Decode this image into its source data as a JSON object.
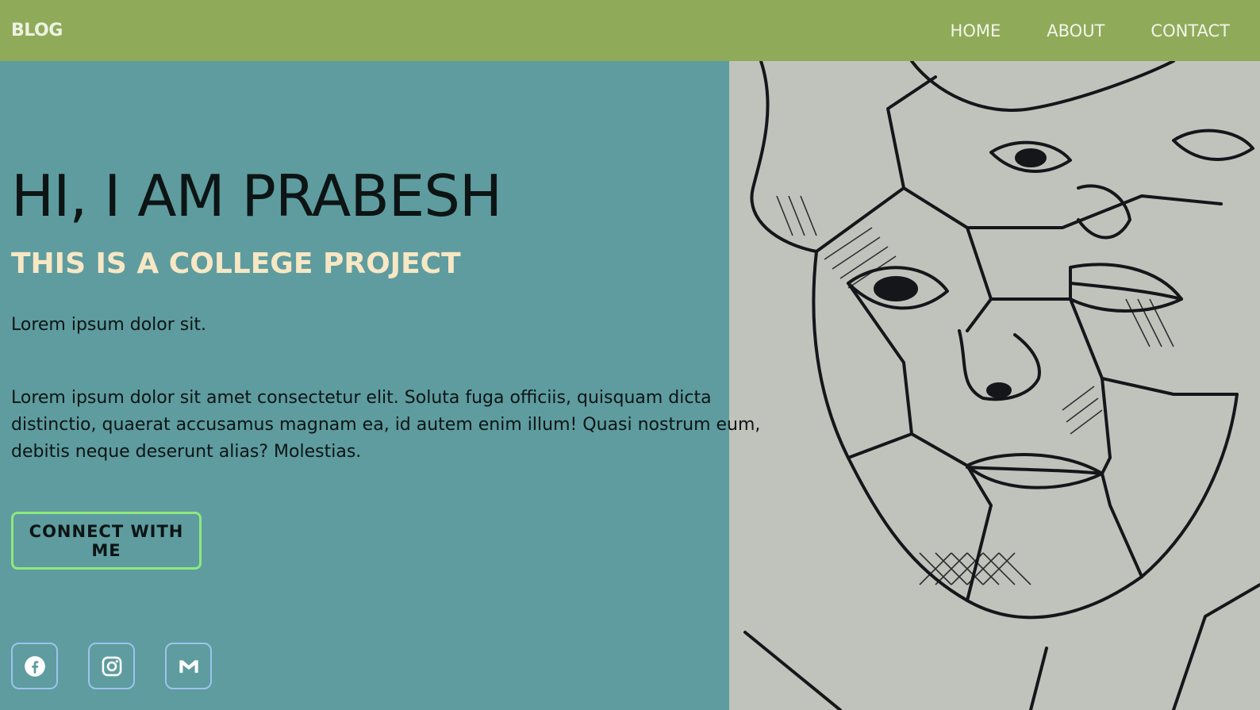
{
  "nav": {
    "brand": "BLOG",
    "links": [
      "HOME",
      "ABOUT",
      "CONTACT"
    ]
  },
  "hero": {
    "title": "HI, I AM PRABESH",
    "subtitle": "THIS IS A COLLEGE PROJECT",
    "short_text": "Lorem ipsum dolor sit.",
    "paragraph": "Lorem ipsum dolor sit amet consectetur elit. Soluta fuga officiis, quisquam dicta distinctio, quaerat accusamus magnam ea, id autem enim illum! Quasi nostrum eum, debitis neque deserunt alias? Molestias.",
    "cta_label": "CONNECT WITH ME"
  },
  "socials": [
    "facebook-icon",
    "instagram-icon",
    "gmail-icon"
  ],
  "colors": {
    "navbar": "#8fab5a",
    "background": "#5e9c9f",
    "subtitle": "#f7e7c4",
    "cta_border": "#8ee87e",
    "social_border": "#9ec3ee"
  }
}
